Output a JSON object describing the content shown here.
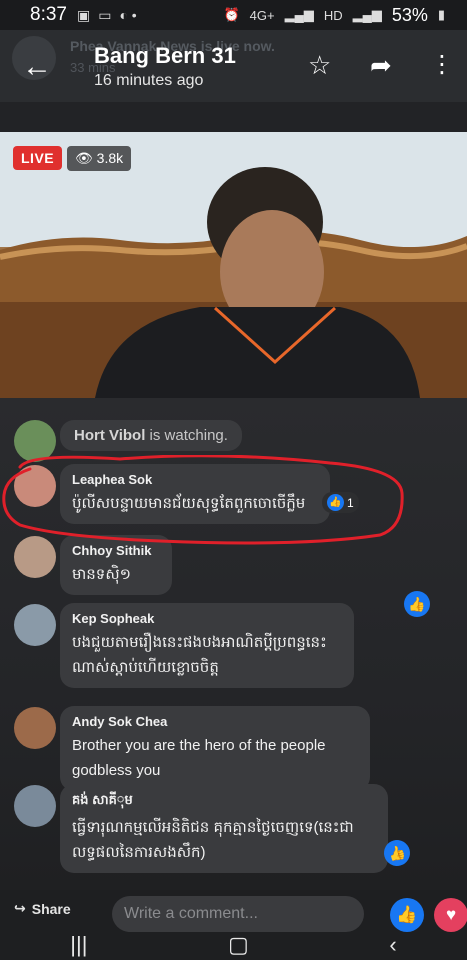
{
  "status_bar": {
    "time": "8:37",
    "network": "4G+",
    "hd": "HD",
    "battery": "53%"
  },
  "header": {
    "title": "Bang Bern 31",
    "subtitle": "16 minutes ago",
    "ghost_line": "Phea Vannak News is live now.",
    "ghost_time": "33 mins"
  },
  "video": {
    "live_label": "LIVE",
    "viewers": "3.8k"
  },
  "watching": {
    "name": "Hort Vibol",
    "suffix": " is watching."
  },
  "comments": [
    {
      "name": "Leaphea Sok",
      "text": "ប៉ូលីសបន្ទាយមានជ័យសុទ្ធតែពួកចោចើក្លឹម",
      "likes": "1"
    },
    {
      "name": "Chhoy Sithik",
      "text": "មានទសុិ១"
    },
    {
      "name": "Kep Sopheak",
      "text": "បងជួយតាមរឿងនេះផងបងអាណិតប្តីប្រពន្ធនេះ",
      "text2": "ណាស់ស្តាប់ហើយខ្លោចចិត្ត"
    },
    {
      "name": "Andy Sok Chea",
      "text": " Brother you are the hero of the people",
      "text2": "godbless you"
    },
    {
      "name": "គង់ សាគីុម",
      "text": "ធ្វើទារុណកម្មលើអនិតិជន គុកគ្មានថ្ងៃចេញទេ(នេះជា",
      "text2": "លទ្ធផលនៃការសងសឹក)"
    }
  ],
  "bottom_bar": {
    "share_label": "Share",
    "comment_placeholder": "Write a comment..."
  },
  "colors": {
    "live": "#e0302e",
    "like": "#1877f2",
    "love": "#e4405f",
    "annotation": "#e0202a"
  }
}
